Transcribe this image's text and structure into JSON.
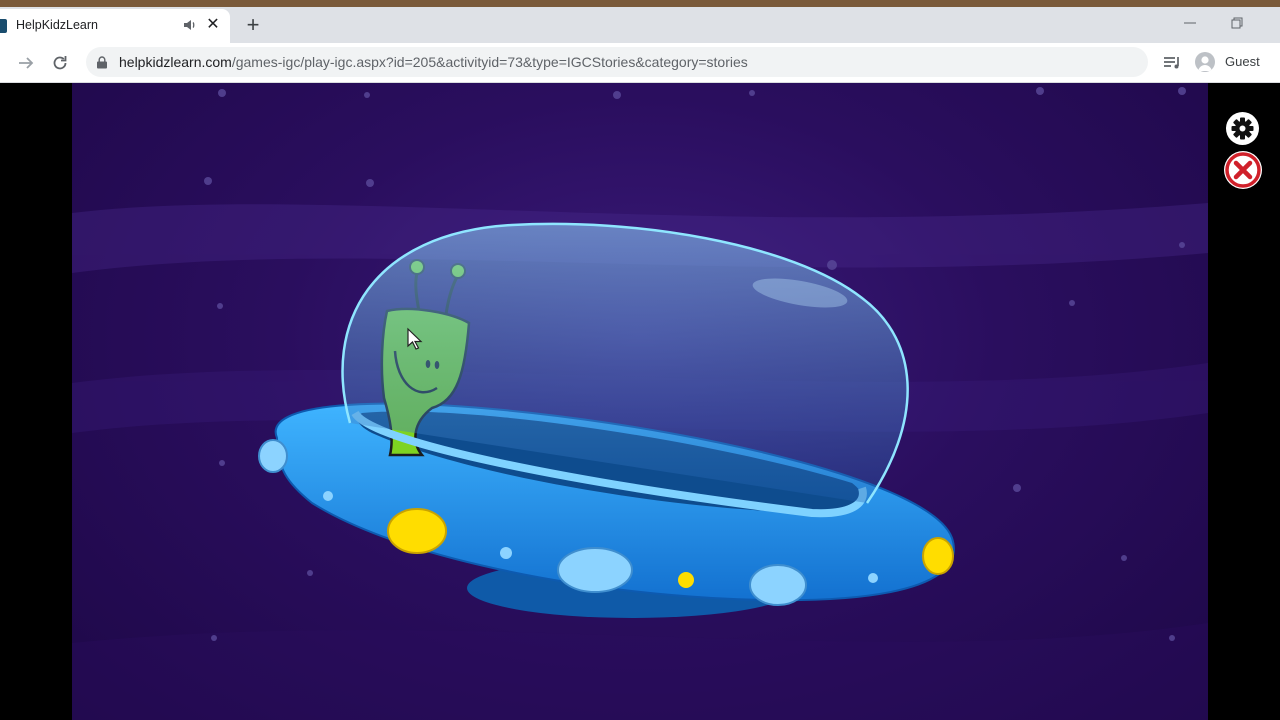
{
  "browser": {
    "tab": {
      "title": "HelpKidzLearn"
    },
    "new_tab_glyph": "+",
    "close_glyph": "✕",
    "address": {
      "domain": "helpkidzlearn.com",
      "path": "/games-igc/play-igc.aspx?id=205&activityid=73&type=IGCStories&category=stories"
    },
    "profile": {
      "label": "Guest"
    }
  },
  "icons": {
    "favicon": "helpkidzlearn-favicon",
    "audio": "speaker-icon",
    "lock": "lock-icon",
    "forward": "arrow-right-icon",
    "reload": "reload-icon",
    "media": "media-queue-icon",
    "settings": "gear-icon",
    "close_game": "close-circle-icon"
  },
  "colors": {
    "stage_bg": "#2a0e5e",
    "ufo_blue": "#1e8fe6",
    "alien_green": "#7ed321",
    "light_yellow": "#ffdd00",
    "close_red": "#d0202a"
  }
}
